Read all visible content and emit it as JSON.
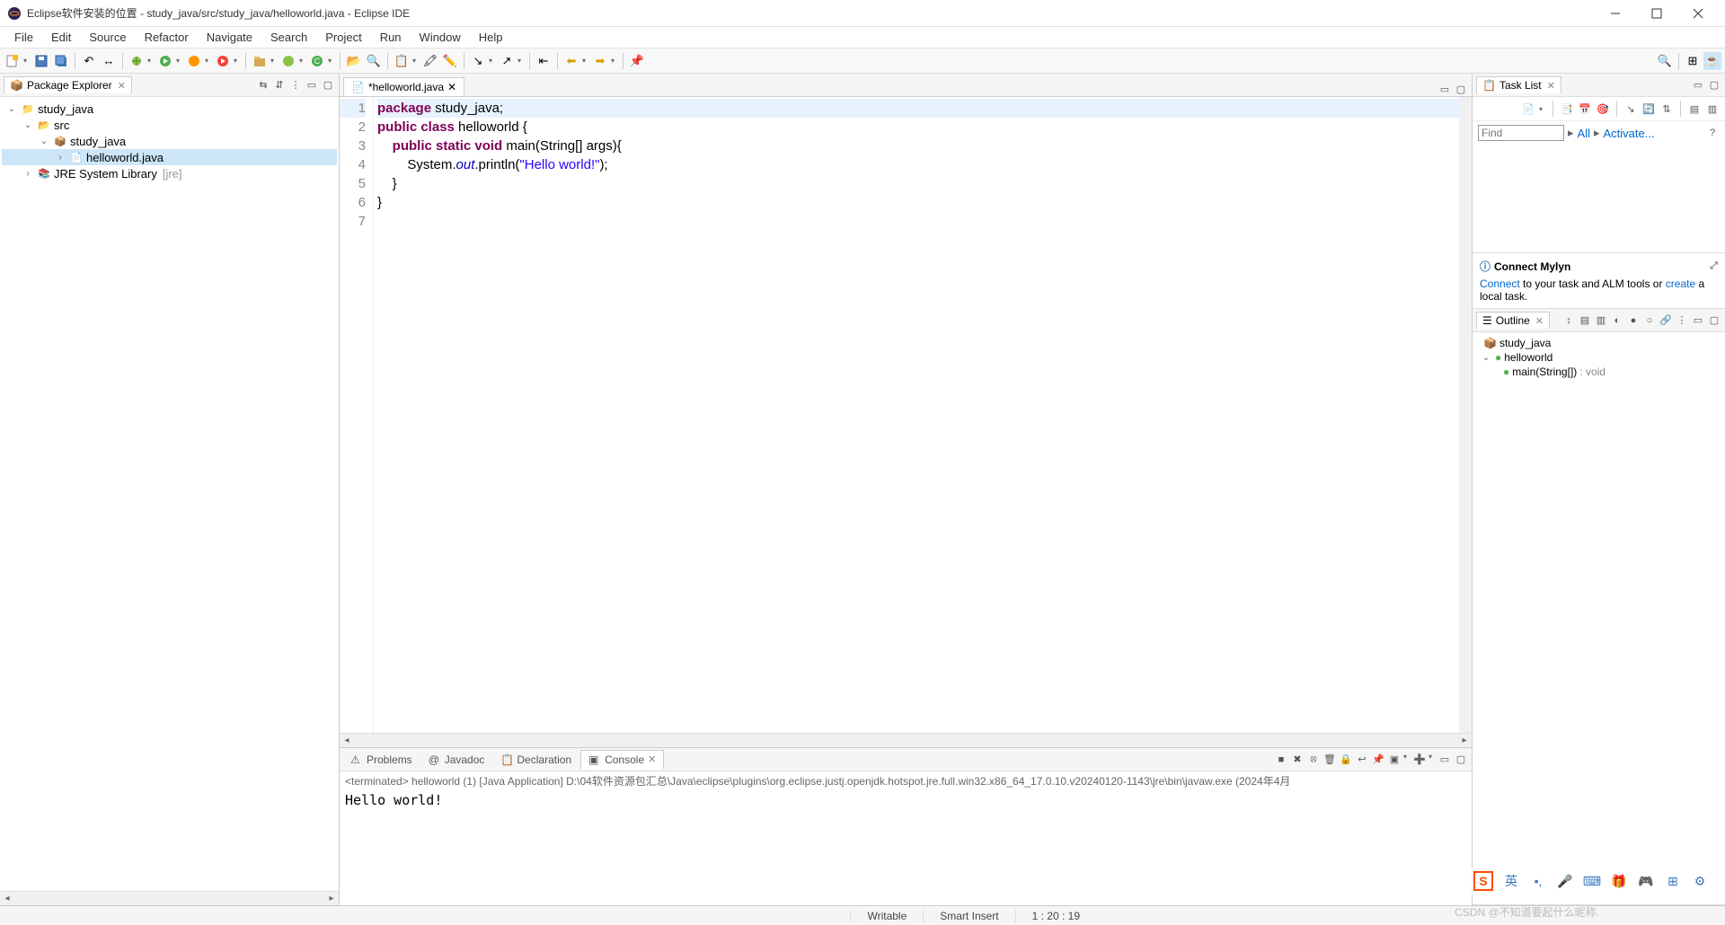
{
  "titlebar": {
    "title": "Eclipse软件安装的位置 - study_java/src/study_java/helloworld.java - Eclipse IDE"
  },
  "menu": [
    "File",
    "Edit",
    "Source",
    "Refactor",
    "Navigate",
    "Search",
    "Project",
    "Run",
    "Window",
    "Help"
  ],
  "package_explorer": {
    "title": "Package Explorer",
    "tree": {
      "project": "study_java",
      "src": "src",
      "pkg": "study_java",
      "file": "helloworld.java",
      "jre": "JRE System Library",
      "jre_ext": "[jre]"
    }
  },
  "editor": {
    "tab": "*helloworld.java",
    "lines": [
      "1",
      "2",
      "3",
      "4",
      "5",
      "6",
      "7"
    ],
    "code": {
      "l1_kw": "package",
      "l1_rest": " study_java;",
      "l2_kw1": "public",
      "l2_kw2": "class",
      "l2_rest": " helloworld {",
      "l3_pre": "    ",
      "l3_kw1": "public",
      "l3_kw2": "static",
      "l3_kw3": "void",
      "l3_rest1": " main(String[] args){",
      "l4_pre": "        System.",
      "l4_out": "out",
      "l4_mid": ".println(",
      "l4_str": "\"Hello world!\"",
      "l4_end": ");",
      "l5": "    }",
      "l6": "}"
    }
  },
  "bottom": {
    "tabs": {
      "problems": "Problems",
      "javadoc": "Javadoc",
      "declaration": "Declaration",
      "console": "Console"
    },
    "console_meta": "<terminated> helloworld (1) [Java Application] D:\\04软件资源包汇总\\Java\\eclipse\\plugins\\org.eclipse.justj.openjdk.hotspot.jre.full.win32.x86_64_17.0.10.v20240120-1143\\jre\\bin\\javaw.exe  (2024年4月",
    "console_out": "Hello world!"
  },
  "tasklist": {
    "title": "Task List",
    "find_placeholder": "Find",
    "all": "All",
    "activate": "Activate..."
  },
  "mylyn": {
    "title": "Connect Mylyn",
    "connect": "Connect",
    "text1": " to your task and ALM tools or ",
    "create": "create",
    "text2": " a local task."
  },
  "outline": {
    "title": "Outline",
    "pkg": "study_java",
    "cls": "helloworld",
    "method": "main(String[])",
    "ret": " : void"
  },
  "status": {
    "writable": "Writable",
    "insert": "Smart Insert",
    "pos": "1 : 20 : 19"
  },
  "watermark": "CSDN @不知道要起什么昵称.",
  "ime_lang": "英"
}
